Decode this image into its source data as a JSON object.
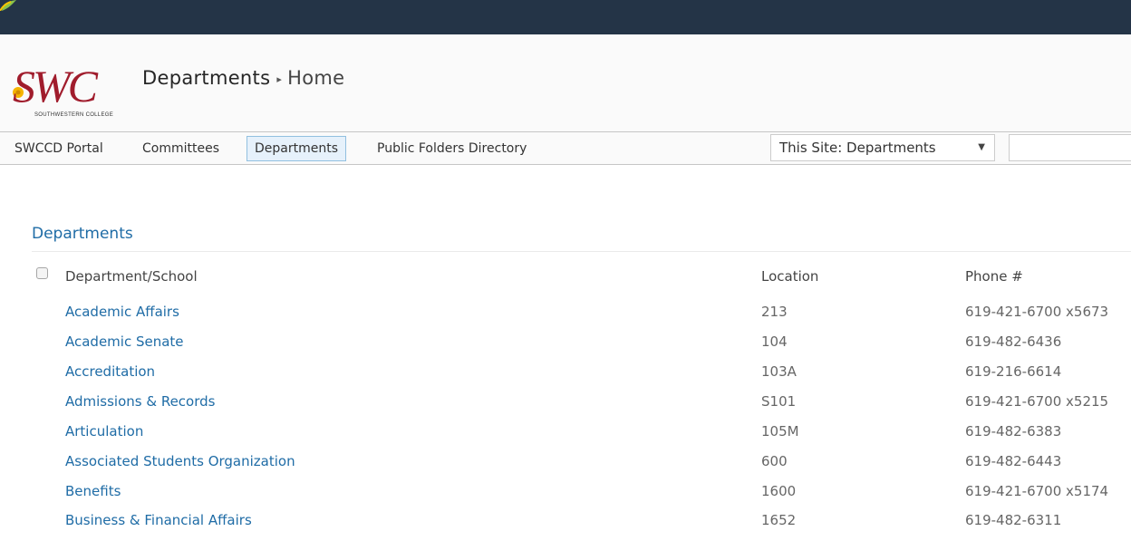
{
  "brand": {
    "logo_text": "SWC",
    "logo_subtext": "SOUTHWESTERN COLLEGE",
    "logo_color": "#a01c2c",
    "accent_color": "#1f6ca6",
    "topbar_color": "#243447"
  },
  "breadcrumb": {
    "site": "Departments",
    "separator_icon": "triangle-right",
    "separator": "▸",
    "page": "Home"
  },
  "nav": {
    "items": [
      {
        "label": "SWCCD Portal",
        "selected": false
      },
      {
        "label": "Committees",
        "selected": false
      },
      {
        "label": "Departments",
        "selected": true
      },
      {
        "label": "Public Folders Directory",
        "selected": false
      }
    ]
  },
  "search": {
    "scope_label": "This Site: Departments",
    "scope_arrow": "▼",
    "placeholder": ""
  },
  "list": {
    "title": "Departments",
    "columns": {
      "name": "Department/School",
      "location": "Location",
      "phone": "Phone #"
    },
    "rows": [
      {
        "name": "Academic Affairs",
        "location": "213",
        "phone": "619-421-6700 x5673"
      },
      {
        "name": "Academic Senate",
        "location": "104",
        "phone": "619-482-6436"
      },
      {
        "name": "Accreditation",
        "location": "103A",
        "phone": "619-216-6614"
      },
      {
        "name": "Admissions & Records",
        "location": "S101",
        "phone": "619-421-6700 x5215"
      },
      {
        "name": "Articulation",
        "location": "105M",
        "phone": "619-482-6383"
      },
      {
        "name": "Associated Students Organization",
        "location": "600",
        "phone": "619-482-6443"
      },
      {
        "name": "Benefits",
        "location": "1600",
        "phone": "619-421-6700 x5174"
      },
      {
        "name": "Business & Financial Affairs",
        "location": "1652",
        "phone": "619-482-6311"
      }
    ]
  }
}
